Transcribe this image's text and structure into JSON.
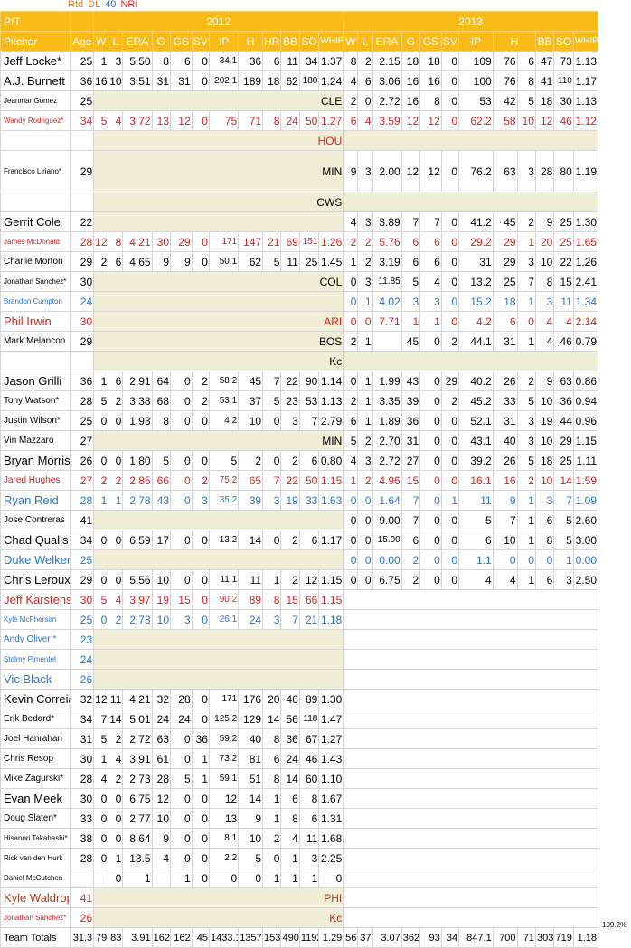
{
  "legend": {
    "items": [
      {
        "label": "Rtd",
        "color": "#e07a1f"
      },
      {
        "label": "DL",
        "color": "#e07a1f"
      },
      {
        "label": "40",
        "color": "#2873d8"
      },
      {
        "label": "NRI",
        "color": "#e02020"
      }
    ]
  },
  "team": "PIT",
  "years": [
    "2012",
    "2013"
  ],
  "columns": {
    "name": "Pitcher",
    "age": "Age",
    "stats": [
      "W",
      "L",
      "ERA",
      "G",
      "GS",
      "SV",
      "IP",
      "H",
      "HR",
      "BB",
      "SO",
      "WHIP"
    ],
    "stats2013": [
      "W",
      "L",
      "ERA",
      "G",
      "GS",
      "SV",
      "IP",
      "H",
      "BB",
      "SO",
      "WHIP"
    ]
  },
  "rows": [
    {
      "name": "Jeff Locke*",
      "age": "25",
      "s12": [
        "1",
        "3",
        "5.50",
        "8",
        "6",
        "0",
        "34.1",
        "36",
        "6",
        "11",
        "34",
        "1.37"
      ],
      "s13": [
        "8",
        "2",
        "2.15",
        "18",
        "18",
        "0",
        "109",
        "76",
        "6",
        "47",
        "73",
        "1.13"
      ]
    },
    {
      "name": "A.J. Burnett",
      "age": "36",
      "s12": [
        "16",
        "10",
        "3.51",
        "31",
        "31",
        "0",
        "202.1",
        "189",
        "18",
        "62",
        "180",
        "1.24"
      ],
      "s13": [
        "4",
        "6",
        "3.06",
        "16",
        "16",
        "0",
        "100",
        "76",
        "8",
        "41",
        "110",
        "1.17"
      ]
    },
    {
      "name": "Jeanmar Gomez",
      "age": "25",
      "small": true,
      "team12": "CLE",
      "s13": [
        "2",
        "0",
        "2.72",
        "16",
        "8",
        "0",
        "53",
        "42",
        "5",
        "18",
        "30",
        "1.13"
      ]
    },
    {
      "name": "Wandy Rodriguez*",
      "age": "34",
      "style": "r",
      "small": true,
      "s12": [
        "5",
        "4",
        "3.72",
        "13",
        "12",
        "0",
        "75",
        "71",
        "8",
        "24",
        "50",
        "1.27"
      ],
      "s13": [
        "6",
        "4",
        "3.59",
        "12",
        "12",
        "0",
        "62.2",
        "58",
        "10",
        "12",
        "46",
        "1.12"
      ]
    },
    {
      "name": "",
      "team12": "HOU",
      "style": "r"
    },
    {
      "name": "Francisco Liriano*",
      "age": "29",
      "small": true,
      "tall": true,
      "team12": "MIN",
      "s13": [
        "9",
        "3",
        "2.00",
        "12",
        "12",
        "0",
        "76.2",
        "63",
        "3",
        "28",
        "80",
        "1.19"
      ]
    },
    {
      "name": "",
      "team12": "CWS"
    },
    {
      "name": "Gerrit Cole",
      "age": "22",
      "s13": [
        "4",
        "3",
        "3.89",
        "7",
        "7",
        "0",
        "41.2",
        "45",
        "2",
        "9",
        "25",
        "1.30"
      ]
    },
    {
      "name": "James McDonald",
      "age": "28",
      "style": "r",
      "small": true,
      "s12": [
        "12",
        "8",
        "4.21",
        "30",
        "29",
        "0",
        "171",
        "147",
        "21",
        "69",
        "151",
        "1.26"
      ],
      "s13": [
        "2",
        "2",
        "5.76",
        "6",
        "6",
        "0",
        "29.2",
        "29",
        "1",
        "20",
        "25",
        "1.65"
      ]
    },
    {
      "name": "Charlie Morton",
      "age": "29",
      "md": true,
      "s12": [
        "2",
        "6",
        "4.65",
        "9",
        "9",
        "0",
        "50.1",
        "62",
        "5",
        "11",
        "25",
        "1.45"
      ],
      "s13": [
        "1",
        "2",
        "3.19",
        "6",
        "6",
        "0",
        "31",
        "29",
        "3",
        "10",
        "22",
        "1.26"
      ]
    },
    {
      "name": "Jonathan Sanchez*",
      "age": "30",
      "small": true,
      "team12": "COL",
      "s13": [
        "0",
        "3",
        "11.85",
        "5",
        "4",
        "0",
        "13.2",
        "25",
        "7",
        "8",
        "15",
        "2.41"
      ]
    },
    {
      "name": "Brandon Cumpton",
      "age": "24",
      "style": "b",
      "small": true,
      "s13": [
        "0",
        "1",
        "4.02",
        "3",
        "3",
        "0",
        "15.2",
        "18",
        "1",
        "3",
        "11",
        "1.34"
      ]
    },
    {
      "name": "Phil Irwin",
      "age": "30",
      "style": "r",
      "team12": "ARI",
      "s13": [
        "0",
        "0",
        "7.71",
        "1",
        "1",
        "0",
        "4.2",
        "6",
        "0",
        "4",
        "4",
        "2.14"
      ]
    },
    {
      "name": "Mark Melancon",
      "age": "29",
      "md": true,
      "team12": "BOS",
      "s13": [
        "2",
        "1",
        "",
        "45",
        "0",
        "2",
        "44.1",
        "31",
        "1",
        "4",
        "46",
        "0.79"
      ]
    },
    {
      "name": "",
      "team12": "Kc"
    },
    {
      "name": "Jason Grilli",
      "age": "36",
      "s12": [
        "1",
        "6",
        "2.91",
        "64",
        "0",
        "2",
        "58.2",
        "45",
        "7",
        "22",
        "90",
        "1.14"
      ],
      "s13": [
        "0",
        "1",
        "1.99",
        "43",
        "0",
        "29",
        "40.2",
        "26",
        "2",
        "9",
        "63",
        "0.86"
      ]
    },
    {
      "name": "Tony Watson*",
      "age": "28",
      "md": true,
      "s12": [
        "5",
        "2",
        "3.38",
        "68",
        "0",
        "2",
        "53.1",
        "37",
        "5",
        "23",
        "53",
        "1.13"
      ],
      "s13": [
        "2",
        "1",
        "3.35",
        "39",
        "0",
        "2",
        "45.2",
        "33",
        "5",
        "10",
        "36",
        "0.94"
      ]
    },
    {
      "name": "Justin Wilson*",
      "age": "25",
      "md": true,
      "s12": [
        "0",
        "0",
        "1.93",
        "8",
        "0",
        "0",
        "4.2",
        "10",
        "0",
        "3",
        "7",
        "2.79"
      ],
      "s13": [
        "6",
        "1",
        "1.89",
        "36",
        "0",
        "0",
        "52.1",
        "31",
        "3",
        "19",
        "44",
        "0.96"
      ]
    },
    {
      "name": "Vin Mazzaro",
      "age": "27",
      "md": true,
      "team12": "MIN",
      "s13": [
        "5",
        "2",
        "2.70",
        "31",
        "0",
        "0",
        "43.1",
        "40",
        "3",
        "10",
        "29",
        "1.15"
      ]
    },
    {
      "name": "Bryan Morris",
      "age": "26",
      "s12": [
        "0",
        "0",
        "1.80",
        "5",
        "0",
        "0",
        "5",
        "2",
        "0",
        "2",
        "6",
        "0.80"
      ],
      "s13": [
        "4",
        "3",
        "2.72",
        "27",
        "0",
        "0",
        "39.2",
        "26",
        "5",
        "18",
        "25",
        "1.11"
      ]
    },
    {
      "name": "Jared Hughes",
      "age": "27",
      "style": "r",
      "md": true,
      "s12": [
        "2",
        "2",
        "2.85",
        "66",
        "0",
        "2",
        "75.2",
        "65",
        "7",
        "22",
        "50",
        "1.15"
      ],
      "s13": [
        "1",
        "2",
        "4.96",
        "15",
        "0",
        "0",
        "16.1",
        "16",
        "2",
        "10",
        "14",
        "1.59"
      ]
    },
    {
      "name": "Ryan Reid",
      "age": "28",
      "style": "b",
      "s12": [
        "1",
        "1",
        "2.78",
        "43",
        "0",
        "3",
        "35.2",
        "39",
        "3",
        "19",
        "33",
        "1.63"
      ],
      "s13": [
        "0",
        "0",
        "1.64",
        "7",
        "0",
        "1",
        "11",
        "9",
        "1",
        "3",
        "7",
        "1.09"
      ]
    },
    {
      "name": "Jose Contreras",
      "age": "41",
      "md": true,
      "s13": [
        "0",
        "0",
        "9.00",
        "7",
        "0",
        "0",
        "5",
        "7",
        "1",
        "6",
        "5",
        "2.60"
      ]
    },
    {
      "name": "Chad Qualls",
      "age": "34",
      "s12": [
        "0",
        "0",
        "6.59",
        "17",
        "0",
        "0",
        "13.2",
        "14",
        "0",
        "2",
        "6",
        "1.17"
      ],
      "s13": [
        "0",
        "0",
        "15.00",
        "6",
        "0",
        "0",
        "6",
        "10",
        "1",
        "8",
        "5",
        "3.00"
      ]
    },
    {
      "name": "Duke Welker",
      "age": "25",
      "style": "b",
      "s13": [
        "0",
        "0",
        "0.00",
        "2",
        "0",
        "0",
        "1.1",
        "0",
        "0",
        "0",
        "1",
        "0.00"
      ]
    },
    {
      "name": "Chris Leroux",
      "age": "29",
      "s12": [
        "0",
        "0",
        "5.56",
        "10",
        "0",
        "0",
        "11.1",
        "11",
        "1",
        "2",
        "12",
        "1.15"
      ],
      "s13": [
        "0",
        "0",
        "6.75",
        "2",
        "0",
        "0",
        "4",
        "4",
        "1",
        "6",
        "3",
        "2.50"
      ]
    },
    {
      "name": "Jeff Karstens",
      "age": "30",
      "style": "r",
      "s12": [
        "5",
        "4",
        "3.97",
        "19",
        "15",
        "0",
        "90.2",
        "89",
        "8",
        "15",
        "66",
        "1.15"
      ]
    },
    {
      "name": "Kyle McPherson",
      "age": "25",
      "style": "b",
      "small": true,
      "s12": [
        "0",
        "2",
        "2.73",
        "10",
        "3",
        "0",
        "26.1",
        "24",
        "3",
        "7",
        "21",
        "1.18"
      ]
    },
    {
      "name": "Andy Oliver *",
      "age": "23",
      "style": "b",
      "md": true
    },
    {
      "name": "Stolmy Pimentel",
      "age": "24",
      "style": "b",
      "small": true
    },
    {
      "name": "Vic Black",
      "age": "26",
      "style": "b"
    },
    {
      "name": "Kevin Correia",
      "age": "32",
      "s12": [
        "12",
        "11",
        "4.21",
        "32",
        "28",
        "0",
        "171",
        "176",
        "20",
        "46",
        "89",
        "1.30"
      ]
    },
    {
      "name": "Erik Bedard*",
      "age": "34",
      "md": true,
      "s12": [
        "7",
        "14",
        "5.01",
        "24",
        "24",
        "0",
        "125.2",
        "129",
        "14",
        "56",
        "118",
        "1.47"
      ]
    },
    {
      "name": "Joel Hanrahan",
      "age": "31",
      "md": true,
      "s12": [
        "5",
        "2",
        "2.72",
        "63",
        "0",
        "36",
        "59.2",
        "40",
        "8",
        "36",
        "67",
        "1.27"
      ]
    },
    {
      "name": "Chris Resop",
      "age": "30",
      "md": true,
      "s12": [
        "1",
        "4",
        "3.91",
        "61",
        "0",
        "1",
        "73.2",
        "81",
        "6",
        "24",
        "46",
        "1.43"
      ]
    },
    {
      "name": "Mike Zagurski*",
      "age": "28",
      "md": true,
      "s12": [
        "4",
        "2",
        "2.73",
        "28",
        "5",
        "1",
        "59.1",
        "51",
        "8",
        "14",
        "60",
        "1.10"
      ]
    },
    {
      "name": "Evan Meek",
      "age": "30",
      "s12": [
        "0",
        "0",
        "6.75",
        "12",
        "0",
        "0",
        "12",
        "14",
        "1",
        "6",
        "8",
        "1.67"
      ]
    },
    {
      "name": "Doug Slaten*",
      "age": "33",
      "md": true,
      "s12": [
        "0",
        "0",
        "2.77",
        "10",
        "0",
        "0",
        "13",
        "9",
        "1",
        "8",
        "6",
        "1.31"
      ]
    },
    {
      "name": "Hisanori Takahashi*",
      "age": "38",
      "small": true,
      "s12": [
        "0",
        "0",
        "8.64",
        "9",
        "0",
        "0",
        "8.1",
        "10",
        "2",
        "4",
        "11",
        "1.68"
      ]
    },
    {
      "name": "Rick van den Hurk",
      "age": "28",
      "small": true,
      "s12": [
        "0",
        "1",
        "13.5",
        "4",
        "0",
        "0",
        "2.2",
        "5",
        "0",
        "1",
        "3",
        "2.25"
      ]
    },
    {
      "name": "Daniel McCutchen",
      "age": "",
      "small": true,
      "s12": [
        "",
        "0",
        "1",
        "",
        "1",
        "0",
        "0",
        "0",
        "1",
        "1",
        "1",
        "0"
      ]
    },
    {
      "name": "Kyle Waldrop",
      "age": "41",
      "style": "br",
      "team12": "PHI"
    },
    {
      "name": "Jonathan Sanchez*",
      "age": "26",
      "style": "r",
      "small": true,
      "team12": "Kc"
    }
  ],
  "totals": {
    "label": "Team Totals",
    "age": "31.3",
    "s12": [
      "79",
      "83",
      "3.91",
      "162",
      "162",
      "45",
      "1433.1",
      "1357",
      "153",
      "490",
      "1192",
      "1.29"
    ],
    "s13": [
      "56",
      "37",
      "3.07",
      "362",
      "93",
      "34",
      "847.1",
      "700",
      "71",
      "303",
      "719",
      "1.18"
    ],
    "pct": "109.2%"
  }
}
